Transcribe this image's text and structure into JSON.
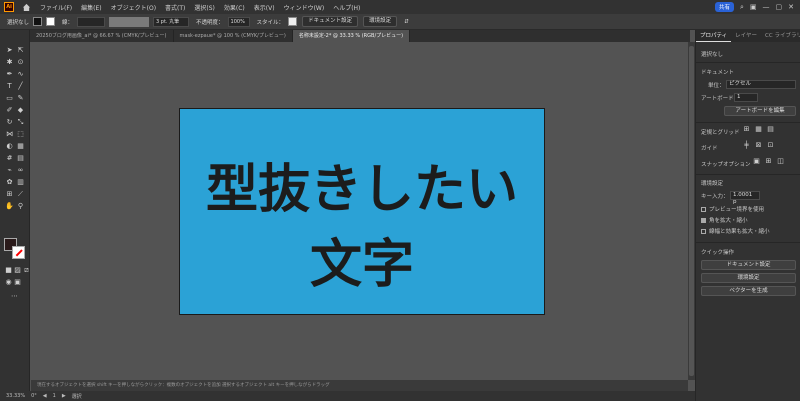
{
  "app": {
    "logo": "Ai"
  },
  "menu": [
    "ファイル(F)",
    "編集(E)",
    "オブジェクト(O)",
    "書式(T)",
    "選択(S)",
    "効果(C)",
    "表示(V)",
    "ウィンドウ(W)",
    "ヘルプ(H)"
  ],
  "share_label": "共有",
  "control": {
    "selection_label": "選択なし",
    "stroke_label": "線：",
    "stroke_width": "3 pt. 丸筆",
    "opacity_label": "不透明度：",
    "opacity_value": "100%",
    "style_label": "スタイル：",
    "doc_settings": "ドキュメント設定",
    "prefs": "環境設定"
  },
  "tabs": [
    {
      "label": "20250ブログ用画像_ai* @ 66.67 % (CMYK/プレビュー)",
      "active": false
    },
    {
      "label": "mask-ezpaue* @ 100 % (CMYK/プレビュー)",
      "active": false
    },
    {
      "label": "名称未設定-2* @ 33.33 % (RGB/プレビュー)",
      "active": true
    }
  ],
  "artboard": {
    "line1": "型抜きしたい",
    "line2": "文字",
    "bg_color": "#2ba2d6"
  },
  "panel": {
    "tabs": [
      "プロパティ",
      "レイヤー",
      "CC ライブラリ"
    ],
    "no_selection": "選択なし",
    "document_heading": "ドキュメント",
    "unit_label": "単位：",
    "unit_value": "ピクセル",
    "artboard_label": "アートボード：",
    "artboard_value": "1",
    "artboard_btn": "アートボードを編集",
    "ruler_label": "定規とグリッド",
    "guide_label": "ガイド",
    "snap_label": "スナップオプション",
    "prefs_heading": "環境設定",
    "key_input_label": "キー入力：",
    "key_input_value": "1.0001 p",
    "preview_bounds": "プレビュー境界を使用",
    "scale_corners": "角を拡大・縮小",
    "scale_strokes": "線幅と効果も拡大・縮小",
    "quick_actions": "クイック操作",
    "qa_doc_settings": "ドキュメント設定",
    "qa_prefs": "環境設定",
    "qa_vectorize": "ベクターを生成"
  },
  "status": {
    "zoom": "33.33%",
    "angle": "0°",
    "artboard_num": "1",
    "mode": "選択",
    "hint": "現在するオブジェクトを選択  shift キーを押しながらクリック：複数のオブジェクトを追加  選択するオブジェクト  alt キーを押しながらドラッグ"
  }
}
